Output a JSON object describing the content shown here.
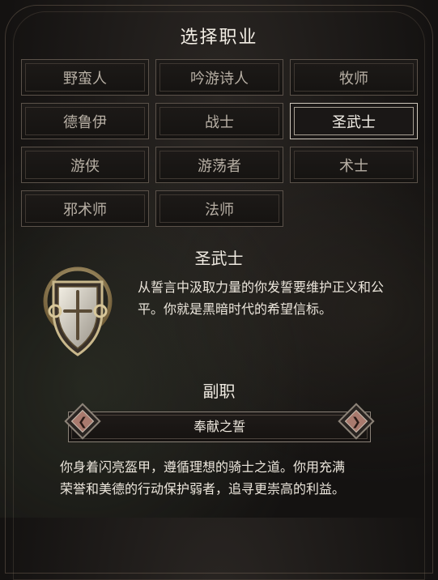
{
  "screen_title": "选择职业",
  "classes": [
    {
      "label": "野蛮人",
      "selected": false
    },
    {
      "label": "吟游诗人",
      "selected": false
    },
    {
      "label": "牧师",
      "selected": false
    },
    {
      "label": "德鲁伊",
      "selected": false
    },
    {
      "label": "战士",
      "selected": false
    },
    {
      "label": "圣武士",
      "selected": true
    },
    {
      "label": "游侠",
      "selected": false
    },
    {
      "label": "游荡者",
      "selected": false
    },
    {
      "label": "术士",
      "selected": false
    },
    {
      "label": "邪术师",
      "selected": false
    },
    {
      "label": "法师",
      "selected": false
    }
  ],
  "selected_class": {
    "name": "圣武士",
    "description_line1": "从誓言中汲取力量的你发誓要维护正义和公",
    "description_line2": "平。你就是黑暗时代的希望信标。",
    "icon": "paladin-shield-icon"
  },
  "subclass": {
    "heading": "副职",
    "current": "奉献之誓",
    "description_line1": "你身着闪亮盔甲，遵循理想的骑士之道。你用充满",
    "description_line2": "荣誉和美德的行动保护弱者，追寻更崇高的利益。",
    "prev_icon": "chevron-left-icon",
    "next_icon": "chevron-right-icon"
  },
  "colors": {
    "background": "#141211",
    "button_border": "#5b524a",
    "selected_border": "#cfc7bb",
    "text": "#e8e2d8"
  }
}
